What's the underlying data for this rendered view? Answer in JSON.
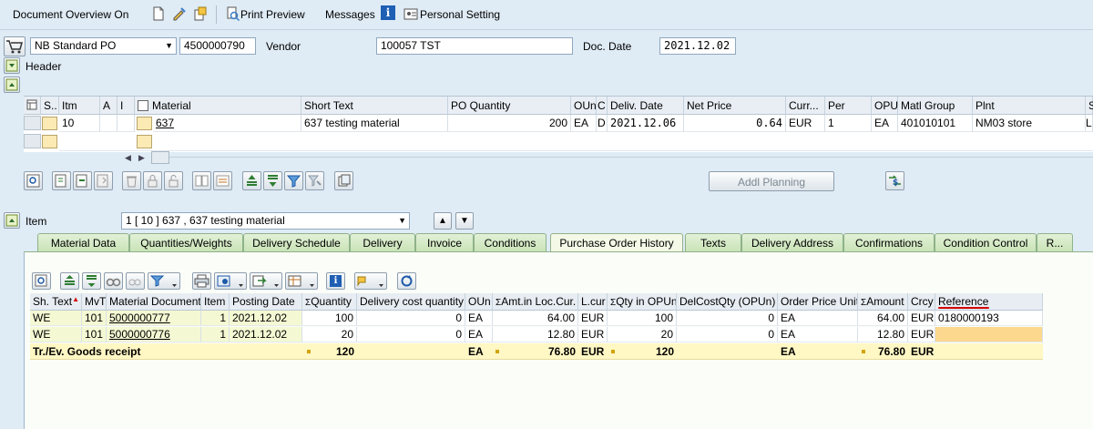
{
  "toolbar": {
    "overview": "Document Overview On",
    "print_preview": "Print Preview",
    "messages": "Messages",
    "personal_setting": "Personal Setting"
  },
  "header": {
    "doc_type": "NB Standard PO",
    "po_number": "4500000790",
    "vendor_label": "Vendor",
    "vendor_value": "100057 TST",
    "doc_date_label": "Doc. Date",
    "doc_date_value": "2021.12.02",
    "header_label": "Header"
  },
  "item_grid": {
    "columns": [
      "S..",
      "Itm",
      "A",
      "I",
      "Material",
      "Short Text",
      "PO Quantity",
      "OUn",
      "C",
      "Deliv. Date",
      "Net Price",
      "Curr...",
      "Per",
      "OPU",
      "Matl Group",
      "Plnt",
      "S"
    ],
    "row": {
      "itm": "10",
      "material": "637",
      "short_text": "637 testing material",
      "po_quantity": "200",
      "oun": "EA",
      "c": "D",
      "deliv_date": "2021.12.06",
      "net_price": "0.64",
      "curr": "EUR",
      "per": "1",
      "opu": "EA",
      "matl_group": "401010101",
      "plnt": "NM03 store",
      "s": "La"
    }
  },
  "addl_planning": "Addl Planning",
  "item": {
    "label": "Item",
    "selected": "1 [ 10 ] 637 , 637 testing material"
  },
  "tabs": [
    "Material Data",
    "Quantities/Weights",
    "Delivery Schedule",
    "Delivery",
    "Invoice",
    "Conditions",
    "Purchase Order History",
    "Texts",
    "Delivery Address",
    "Confirmations",
    "Condition Control",
    "R..."
  ],
  "history": {
    "columns": [
      "Sh. Text",
      "MvT",
      "Material Document",
      "Item",
      "Posting Date",
      "Quantity",
      "Delivery cost quantity",
      "OUn",
      "Amt.in Loc.Cur.",
      "L.cur",
      "Qty in OPUn",
      "DelCostQty (OPUn)",
      "Order Price Unit",
      "Amount",
      "Crcy",
      "Reference"
    ],
    "rows": [
      [
        "WE",
        "101",
        "5000000777",
        "1",
        "2021.12.02",
        "100",
        "0",
        "EA",
        "64.00",
        "EUR",
        "100",
        "0",
        "EA",
        "64.00",
        "EUR",
        "0180000193"
      ],
      [
        "WE",
        "101",
        "5000000776",
        "1",
        "2021.12.02",
        "20",
        "0",
        "EA",
        "12.80",
        "EUR",
        "20",
        "0",
        "EA",
        "12.80",
        "EUR",
        ""
      ]
    ],
    "total": {
      "label": "Tr./Ev. Goods receipt",
      "quantity": "120",
      "oun": "EA",
      "amt_loc": "76.80",
      "lcur": "EUR",
      "qty_opun": "120",
      "opu": "EA",
      "amount": "76.80",
      "crcy": "EUR"
    }
  },
  "colors": {
    "active_tab_underline": "#d40000",
    "key_col": "#f5f9d3",
    "total_row": "#fff7c4"
  }
}
